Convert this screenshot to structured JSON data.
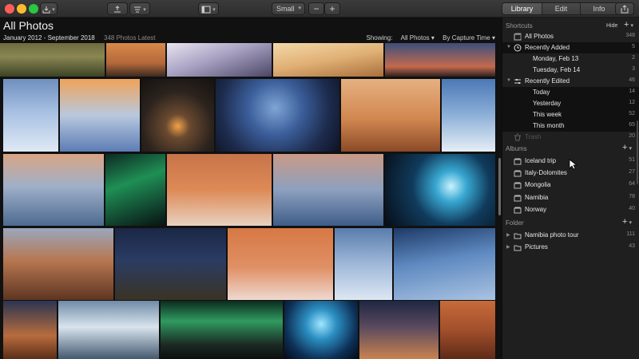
{
  "toolbar": {
    "size_label": "Small",
    "zoom_out": "−",
    "zoom_in": "+",
    "tabs": [
      "Library",
      "Edit",
      "Info"
    ]
  },
  "header": {
    "title": "All Photos",
    "date_range": "January 2012 - September 2018",
    "photo_count": "348 Photos Latest",
    "showing_label": "Showing:",
    "showing_value": "All Photos",
    "sort_value": "By Capture Time"
  },
  "sidebar": {
    "shortcuts_label": "Shortcuts",
    "hide_label": "Hide",
    "add_label": "+",
    "shortcuts": [
      {
        "label": "All Photos",
        "count": "348"
      },
      {
        "label": "Recently Added",
        "count": "5"
      },
      {
        "label": "Monday, Feb 13",
        "count": "2"
      },
      {
        "label": "Tuesday, Feb 14",
        "count": "3"
      },
      {
        "label": "Recently Edited",
        "count": "46"
      },
      {
        "label": "Today",
        "count": "14"
      },
      {
        "label": "Yesterday",
        "count": "12"
      },
      {
        "label": "This week",
        "count": "52"
      },
      {
        "label": "This month",
        "count": "65"
      },
      {
        "label": "Trash",
        "count": "20"
      }
    ],
    "albums_label": "Albums",
    "albums": [
      {
        "label": "Iceland trip",
        "count": "51"
      },
      {
        "label": "Italy-Dolomites",
        "count": "27"
      },
      {
        "label": "Mongolia",
        "count": "64"
      },
      {
        "label": "Namibia",
        "count": "78"
      },
      {
        "label": "Norway",
        "count": "40"
      }
    ],
    "folder_label": "Folder",
    "folders": [
      {
        "label": "Namibia photo tour",
        "count": "111"
      },
      {
        "label": "Pictures",
        "count": "43"
      }
    ]
  },
  "colors": {
    "accent_tab": "#5a5a5a",
    "sidebar_bg": "#1f1f1f",
    "grid_bg": "#111111"
  }
}
